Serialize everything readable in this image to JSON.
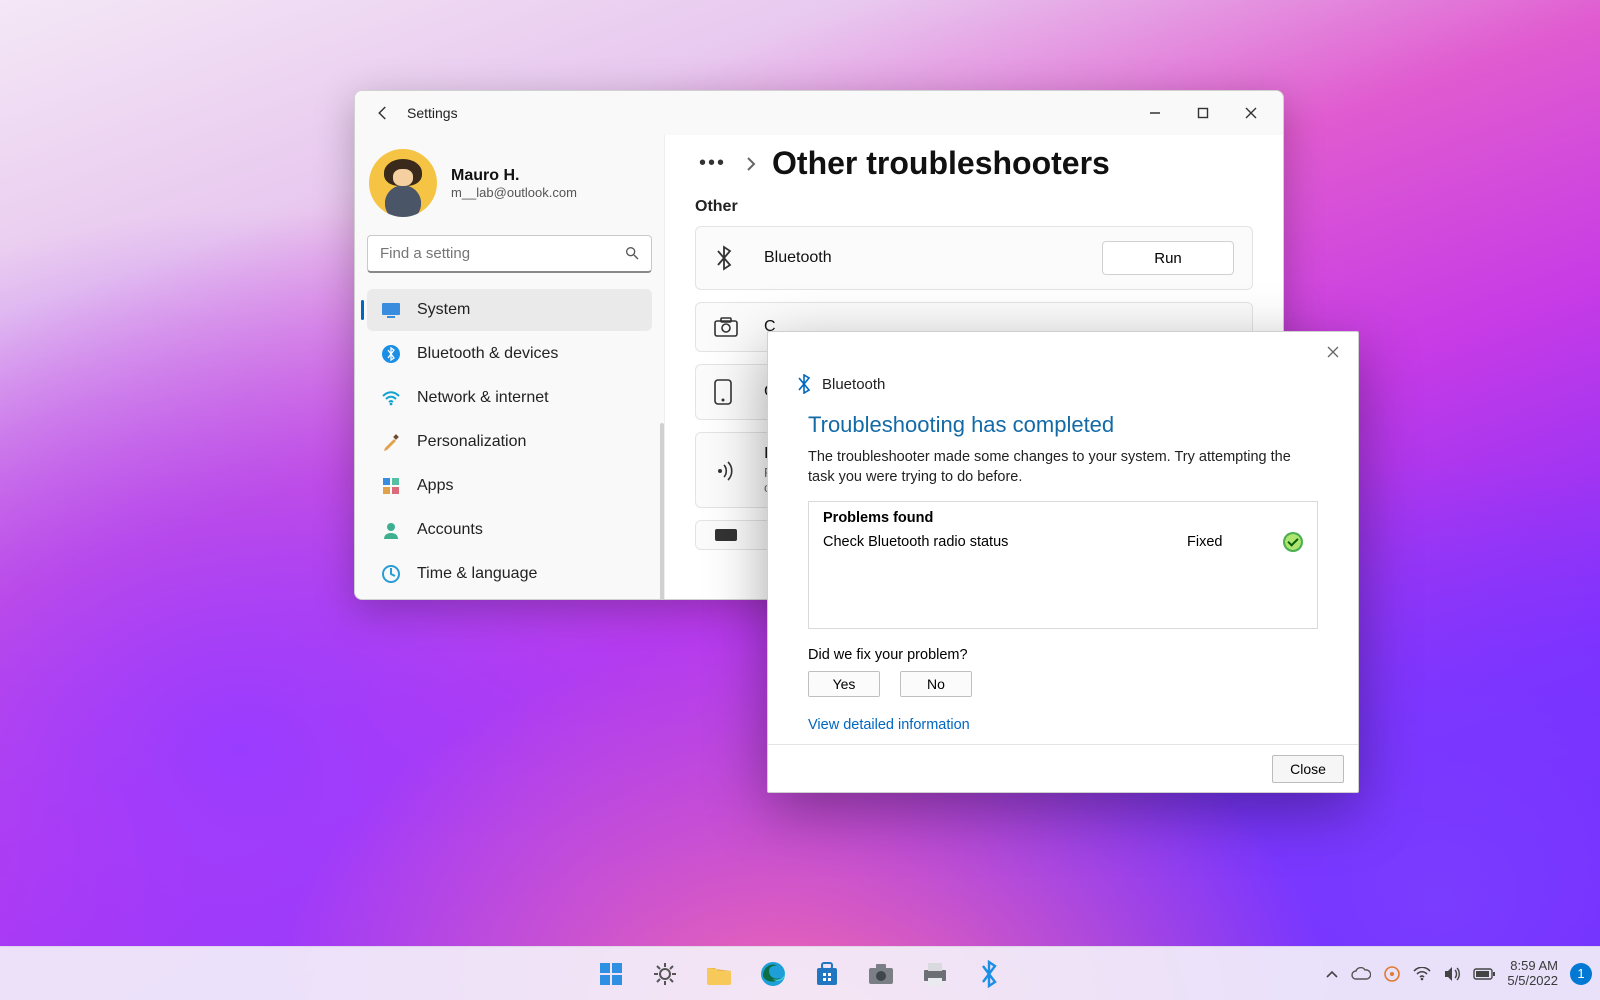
{
  "window": {
    "title": "Settings",
    "user": {
      "name": "Mauro H.",
      "email": "m__lab@outlook.com"
    },
    "search": {
      "placeholder": "Find a setting"
    }
  },
  "sidebar": {
    "items": [
      {
        "label": "System"
      },
      {
        "label": "Bluetooth & devices"
      },
      {
        "label": "Network & internet"
      },
      {
        "label": "Personalization"
      },
      {
        "label": "Apps"
      },
      {
        "label": "Accounts"
      },
      {
        "label": "Time & language"
      }
    ],
    "active_index": 0
  },
  "page": {
    "title": "Other troubleshooters",
    "section_label": "Other",
    "run_label": "Run",
    "items": [
      {
        "label": "Bluetooth",
        "sub": ""
      },
      {
        "label": "C",
        "sub": ""
      },
      {
        "label": "C",
        "sub": ""
      },
      {
        "label": "I",
        "sub": "Fi\nco"
      }
    ]
  },
  "dialog": {
    "app": "Bluetooth",
    "heading": "Troubleshooting has completed",
    "body": "The troubleshooter made some changes to your system. Try attempting the task you were trying to do before.",
    "problems_heading": "Problems found",
    "problems": [
      {
        "name": "Check Bluetooth radio status",
        "status": "Fixed"
      }
    ],
    "fix_question": "Did we fix your problem?",
    "yes": "Yes",
    "no": "No",
    "detail_link": "View detailed information",
    "close": "Close"
  },
  "taskbar": {
    "time": "8:59 AM",
    "date": "5/5/2022",
    "notification_count": "1"
  }
}
